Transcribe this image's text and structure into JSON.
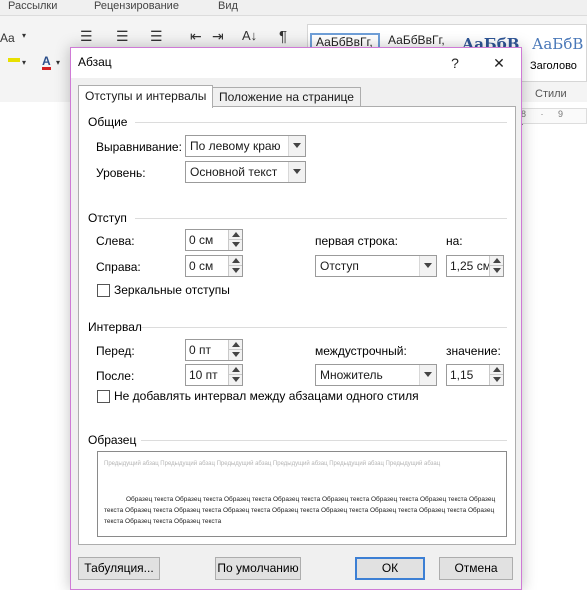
{
  "ribbon": {
    "menu": [
      "Рассылки",
      "Рецензирование",
      "Вид"
    ],
    "font_size_tool": "Aa",
    "font_color_tool": "A",
    "pilcrow": "¶",
    "sort_tool": "A↓",
    "styles": [
      {
        "preview": "АаБбВвГг,",
        "selected": true
      },
      {
        "preview": "АаБбВвГг,",
        "selected": false
      },
      {
        "preview": "АаБбВ",
        "selected": false
      },
      {
        "preview": "АаБбВ",
        "selected": false
      }
    ],
    "style_caption": "Заголово",
    "styles_group_label": "Стили",
    "ruler": "8 · 9 ·"
  },
  "dialog": {
    "title": "Абзац",
    "help": "?",
    "close": "✕",
    "tabs": [
      "Отступы и интервалы",
      "Положение на странице"
    ],
    "general": {
      "heading": "Общие",
      "alignment_label": "Выравнивание:",
      "alignment_value": "По левому краю",
      "level_label": "Уровень:",
      "level_value": "Основной текст"
    },
    "indent": {
      "heading": "Отступ",
      "left_label": "Слева:",
      "left_value": "0 см",
      "right_label": "Справа:",
      "right_value": "0 см",
      "first_line_label": "первая строка:",
      "first_line_value": "Отступ",
      "by_label": "на:",
      "by_value": "1,25 см",
      "mirror_label": "Зеркальные отступы",
      "mirror_checked": false
    },
    "spacing": {
      "heading": "Интервал",
      "before_label": "Перед:",
      "before_value": "0 пт",
      "after_label": "После:",
      "after_value": "10 пт",
      "line_label": "междустрочный:",
      "line_value": "Множитель",
      "at_label": "значение:",
      "at_value": "1,15",
      "no_space_label": "Не добавлять интервал между абзацами одного стиля",
      "no_space_checked": false
    },
    "sample": {
      "heading": "Образец",
      "previous_text": "Предыдущий абзац Предыдущий абзац Предыдущий абзац Предыдущий абзац Предыдущий абзац Предыдущий абзац",
      "sample_text": "Образец текста Образец текста Образец текста Образец текста Образец текста Образец текста Образец текста Образец текста Образец текста Образец текста Образец текста Образец текста Образец текста Образец текста Образец текста Образец текста Образец текста Образец текста"
    },
    "buttons": {
      "tabs": "Табуляция...",
      "default": "По умолчанию",
      "ok": "ОК",
      "cancel": "Отмена"
    }
  }
}
